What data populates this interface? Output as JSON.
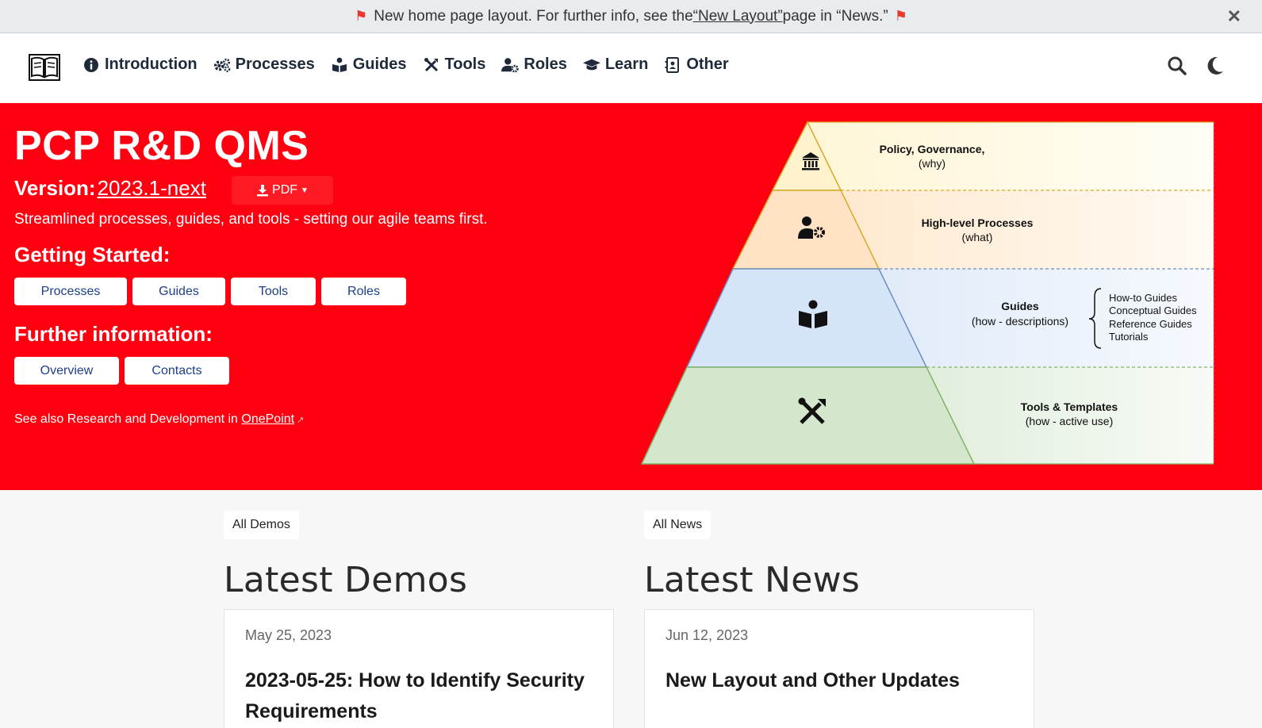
{
  "banner": {
    "text_before": "New home page layout. For further info, see the ",
    "link_text": "“New Layout”",
    "text_after": " page in “News.”",
    "close_label": "✕"
  },
  "nav": {
    "items": [
      {
        "label": "Introduction",
        "icon": "info-circle-icon"
      },
      {
        "label": "Processes",
        "icon": "gears-icon"
      },
      {
        "label": "Guides",
        "icon": "book-reader-icon"
      },
      {
        "label": "Tools",
        "icon": "tools-icon"
      },
      {
        "label": "Roles",
        "icon": "user-cog-icon"
      },
      {
        "label": "Learn",
        "icon": "graduation-cap-icon"
      },
      {
        "label": "Other",
        "icon": "address-book-icon"
      }
    ],
    "right_icons": [
      "search-icon",
      "moon-icon"
    ]
  },
  "hero": {
    "title": "PCP R&D QMS",
    "version_label": "Version:",
    "version_value": " 2023.1-next ",
    "pdf_label": "PDF",
    "tagline": "Streamlined processes, guides, and tools - setting our agile teams first.",
    "getting_started": "Getting Started:",
    "getting_buttons": [
      "Processes",
      "Guides",
      "Tools",
      "Roles"
    ],
    "further_info": "Further information:",
    "further_buttons": [
      "Overview",
      "Contacts"
    ],
    "see_also_text": "See also Research and Development in ",
    "see_also_link": "OnePoint"
  },
  "pyramid": {
    "levels": [
      {
        "title": "Policy, Governance,",
        "sub": "(why)",
        "icon": "landmark-icon"
      },
      {
        "title": "High-level Processes",
        "sub": "(what)",
        "icon": "user-cog-icon"
      },
      {
        "title": "Guides",
        "sub": "(how - descriptions)",
        "icon": "book-reader-icon"
      },
      {
        "title": "Tools & Templates",
        "sub": "(how - active use)",
        "icon": "tools-icon"
      }
    ],
    "guide_types": [
      "How-to Guides",
      "Conceptual Guides",
      "Reference Guides",
      "Tutorials"
    ],
    "colors": {
      "level1": "#fff6d6",
      "level2": "#ffe8cc",
      "level3": "#dce8f8",
      "level4": "#d8e8d2"
    }
  },
  "demos": {
    "pill": "All Demos",
    "heading": "Latest Demos",
    "date": "May 25, 2023",
    "title": "2023-05-25: How to Identify Security Requirements"
  },
  "news": {
    "pill": "All News",
    "heading": "Latest News",
    "date": "Jun 12, 2023",
    "title": "New Layout and Other Updates"
  },
  "colors": {
    "hero": "#ff0010",
    "nav_text": "#1e2a3a",
    "button_text": "#1d3f8a"
  }
}
